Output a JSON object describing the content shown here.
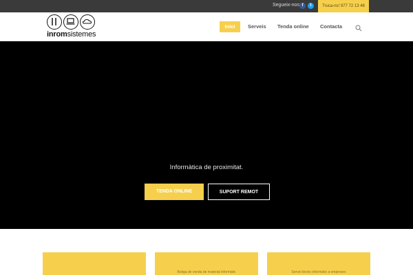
{
  "topbar": {
    "follow_label": "Segueix-nos:",
    "social": [
      "facebook-icon",
      "twitter-icon"
    ],
    "phone_label": "Truca-ns! 977 72 13 48"
  },
  "header": {
    "logo_text_bold": "inrom",
    "logo_text_light": "sistemes",
    "nav": {
      "inici": "Inici",
      "serveis": "Serveis",
      "tenda": "Tenda online",
      "contacta": "Contacta"
    }
  },
  "hero": {
    "tagline": "Informàtica de proximitat.",
    "btn_shop": "Tenda online",
    "btn_remote": "Suport remot"
  },
  "cards": [
    {
      "text": ""
    },
    {
      "text": "Botiga de venda de material informàtic"
    },
    {
      "text": "Servei tècnic informàtic a empreses"
    }
  ],
  "colors": {
    "accent": "#f6d04d",
    "topbar": "#3a3a3a",
    "hero_bg": "#000000"
  }
}
